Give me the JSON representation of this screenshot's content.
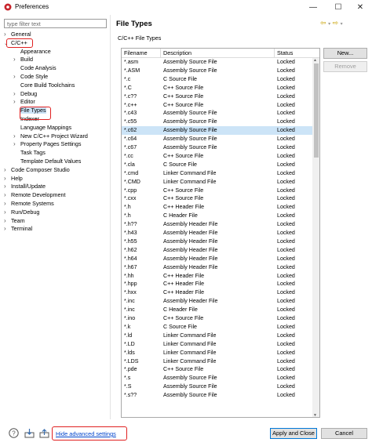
{
  "window": {
    "title": "Preferences",
    "minimize_glyph": "—",
    "maximize_glyph": "☐",
    "close_glyph": "✕"
  },
  "filter": {
    "placeholder": "type filter text"
  },
  "tree": [
    {
      "label": "General",
      "expanded": false,
      "has_children": true,
      "indent": 0
    },
    {
      "label": "C/C++",
      "expanded": true,
      "has_children": true,
      "indent": 0,
      "highlighted": true
    },
    {
      "label": "Appearance",
      "has_children": false,
      "indent": 1
    },
    {
      "label": "Build",
      "expanded": false,
      "has_children": true,
      "indent": 1
    },
    {
      "label": "Code Analysis",
      "has_children": false,
      "indent": 1
    },
    {
      "label": "Code Style",
      "expanded": false,
      "has_children": true,
      "indent": 1
    },
    {
      "label": "Core Build Toolchains",
      "has_children": false,
      "indent": 1
    },
    {
      "label": "Debug",
      "expanded": false,
      "has_children": true,
      "indent": 1
    },
    {
      "label": "Editor",
      "expanded": false,
      "has_children": true,
      "indent": 1
    },
    {
      "label": "File Types",
      "has_children": false,
      "indent": 1,
      "selected": true,
      "highlighted": true
    },
    {
      "label": "Indexer",
      "has_children": false,
      "indent": 1
    },
    {
      "label": "Language Mappings",
      "has_children": false,
      "indent": 1
    },
    {
      "label": "New C/C++ Project Wizard",
      "expanded": false,
      "has_children": true,
      "indent": 1
    },
    {
      "label": "Property Pages Settings",
      "expanded": false,
      "has_children": true,
      "indent": 1
    },
    {
      "label": "Task Tags",
      "has_children": false,
      "indent": 1
    },
    {
      "label": "Template Default Values",
      "has_children": false,
      "indent": 1
    },
    {
      "label": "Code Composer Studio",
      "expanded": false,
      "has_children": true,
      "indent": 0
    },
    {
      "label": "Help",
      "expanded": false,
      "has_children": true,
      "indent": 0
    },
    {
      "label": "Install/Update",
      "expanded": false,
      "has_children": true,
      "indent": 0
    },
    {
      "label": "Remote Development",
      "expanded": false,
      "has_children": true,
      "indent": 0
    },
    {
      "label": "Remote Systems",
      "expanded": false,
      "has_children": true,
      "indent": 0
    },
    {
      "label": "Run/Debug",
      "expanded": false,
      "has_children": true,
      "indent": 0
    },
    {
      "label": "Team",
      "expanded": false,
      "has_children": true,
      "indent": 0
    },
    {
      "label": "Terminal",
      "expanded": false,
      "has_children": true,
      "indent": 0
    }
  ],
  "page": {
    "title": "File Types",
    "subtitle": "C/C++ File Types",
    "nav_back_glyph": "⇦",
    "nav_forward_glyph": "⇨"
  },
  "table": {
    "headers": [
      "Filename",
      "Description",
      "Status"
    ],
    "selected_index": 8,
    "rows": [
      [
        "*.asm",
        "Assembly Source File",
        "Locked"
      ],
      [
        "*.ASM",
        "Assembly Source File",
        "Locked"
      ],
      [
        "*.c",
        "C Source File",
        "Locked"
      ],
      [
        "*.C",
        "C++ Source File",
        "Locked"
      ],
      [
        "*.c??",
        "C++ Source File",
        "Locked"
      ],
      [
        "*.c++",
        "C++ Source File",
        "Locked"
      ],
      [
        "*.c43",
        "Assembly Source File",
        "Locked"
      ],
      [
        "*.c55",
        "Assembly Source File",
        "Locked"
      ],
      [
        "*.c62",
        "Assembly Source File",
        "Locked"
      ],
      [
        "*.c64",
        "Assembly Source File",
        "Locked"
      ],
      [
        "*.c67",
        "Assembly Source File",
        "Locked"
      ],
      [
        "*.cc",
        "C++ Source File",
        "Locked"
      ],
      [
        "*.cla",
        "C Source File",
        "Locked"
      ],
      [
        "*.cmd",
        "Linker Command File",
        "Locked"
      ],
      [
        "*.CMD",
        "Linker Command File",
        "Locked"
      ],
      [
        "*.cpp",
        "C++ Source File",
        "Locked"
      ],
      [
        "*.cxx",
        "C++ Source File",
        "Locked"
      ],
      [
        "*.h",
        "C++ Header File",
        "Locked"
      ],
      [
        "*.h",
        "C Header File",
        "Locked"
      ],
      [
        "*.h??",
        "Assembly Header File",
        "Locked"
      ],
      [
        "*.h43",
        "Assembly Header File",
        "Locked"
      ],
      [
        "*.h55",
        "Assembly Header File",
        "Locked"
      ],
      [
        "*.h62",
        "Assembly Header File",
        "Locked"
      ],
      [
        "*.h64",
        "Assembly Header File",
        "Locked"
      ],
      [
        "*.h67",
        "Assembly Header File",
        "Locked"
      ],
      [
        "*.hh",
        "C++ Header File",
        "Locked"
      ],
      [
        "*.hpp",
        "C++ Header File",
        "Locked"
      ],
      [
        "*.hxx",
        "C++ Header File",
        "Locked"
      ],
      [
        "*.inc",
        "Assembly Header File",
        "Locked"
      ],
      [
        "*.inc",
        "C Header File",
        "Locked"
      ],
      [
        "*.ino",
        "C++ Source File",
        "Locked"
      ],
      [
        "*.k",
        "C Source File",
        "Locked"
      ],
      [
        "*.ld",
        "Linker Command File",
        "Locked"
      ],
      [
        "*.LD",
        "Linker Command File",
        "Locked"
      ],
      [
        "*.lds",
        "Linker Command File",
        "Locked"
      ],
      [
        "*.LDS",
        "Linker Command File",
        "Locked"
      ],
      [
        "*.pde",
        "C++ Source File",
        "Locked"
      ],
      [
        "*.s",
        "Assembly Source File",
        "Locked"
      ],
      [
        "*.S",
        "Assembly Source File",
        "Locked"
      ],
      [
        "*.s??",
        "Assembly Source File",
        "Locked"
      ]
    ]
  },
  "buttons": {
    "new": "New...",
    "remove": "Remove",
    "apply_close": "Apply and Close",
    "cancel": "Cancel"
  },
  "footer": {
    "advanced_link": "Hide advanced settings"
  },
  "colors": {
    "highlight_box": "#e02020",
    "selected_row": "#cce4f7",
    "link": "#0044cc",
    "app_icon": "#c8242c"
  }
}
